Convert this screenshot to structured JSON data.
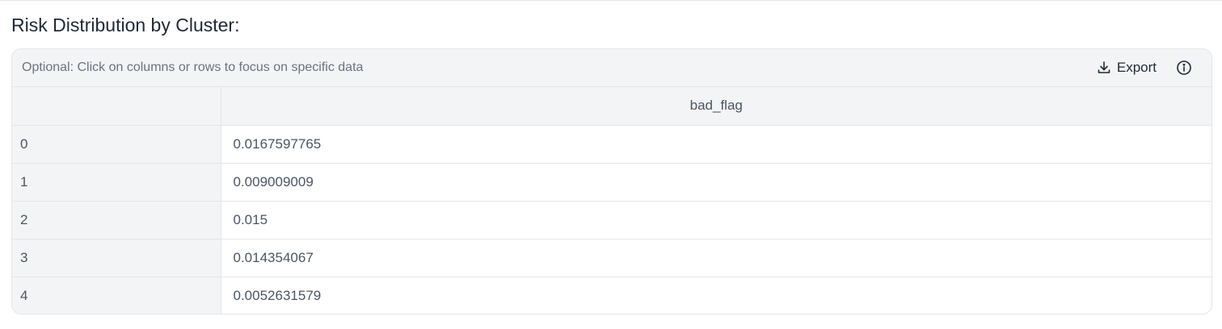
{
  "section": {
    "title": "Risk Distribution by Cluster:"
  },
  "toolbar": {
    "hint": "Optional: Click on columns or rows to focus on specific data",
    "export_label": "Export",
    "export_icon": "download-icon",
    "info_icon": "info-icon"
  },
  "table": {
    "columns": [
      "",
      "bad_flag"
    ],
    "rows": [
      {
        "index": "0",
        "bad_flag": "0.0167597765"
      },
      {
        "index": "1",
        "bad_flag": "0.009009009"
      },
      {
        "index": "2",
        "bad_flag": "0.015"
      },
      {
        "index": "3",
        "bad_flag": "0.014354067"
      },
      {
        "index": "4",
        "bad_flag": "0.0052631579"
      }
    ]
  },
  "colors": {
    "header_bg": "#f3f4f6",
    "border": "#e2e5ea",
    "text_muted": "#6b7280",
    "text_body": "#4b5563",
    "text_dark": "#1f2937"
  }
}
